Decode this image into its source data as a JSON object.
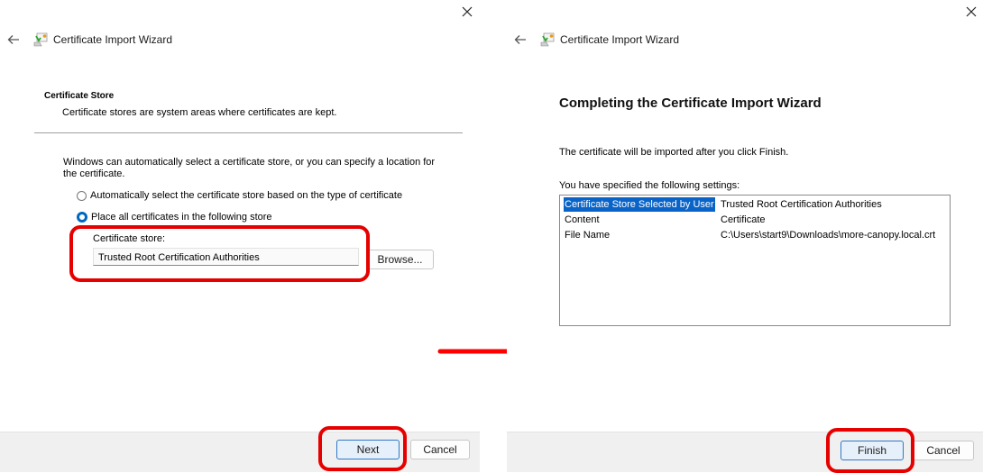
{
  "left_window": {
    "title": "Certificate Import Wizard",
    "section_title": "Certificate Store",
    "section_subtitle": "Certificate stores are system areas where certificates are kept.",
    "description": "Windows can automatically select a certificate store, or you can specify a location for the certificate.",
    "radio_options": [
      {
        "label": "Automatically select the certificate store based on the type of certificate",
        "selected": false
      },
      {
        "label": "Place all certificates in the following store",
        "selected": true
      }
    ],
    "store_label": "Certificate store:",
    "store_value": "Trusted Root Certification Authorities",
    "browse_label": "Browse...",
    "next_label": "Next",
    "cancel_label": "Cancel"
  },
  "right_window": {
    "title": "Certificate Import Wizard",
    "heading": "Completing the Certificate Import Wizard",
    "info": "The certificate will be imported after you click Finish.",
    "settings_label": "You have specified the following settings:",
    "settings": [
      {
        "key": "Certificate Store Selected by User",
        "value": "Trusted Root Certification Authorities",
        "selected": true
      },
      {
        "key": "Content",
        "value": "Certificate",
        "selected": false
      },
      {
        "key": "File Name",
        "value": "C:\\Users\\start9\\Downloads\\more-canopy.local.crt",
        "selected": false
      }
    ],
    "finish_label": "Finish",
    "cancel_label": "Cancel"
  },
  "annotation": {
    "highlight_color": "#e60000",
    "arrow": "right-arrow"
  }
}
